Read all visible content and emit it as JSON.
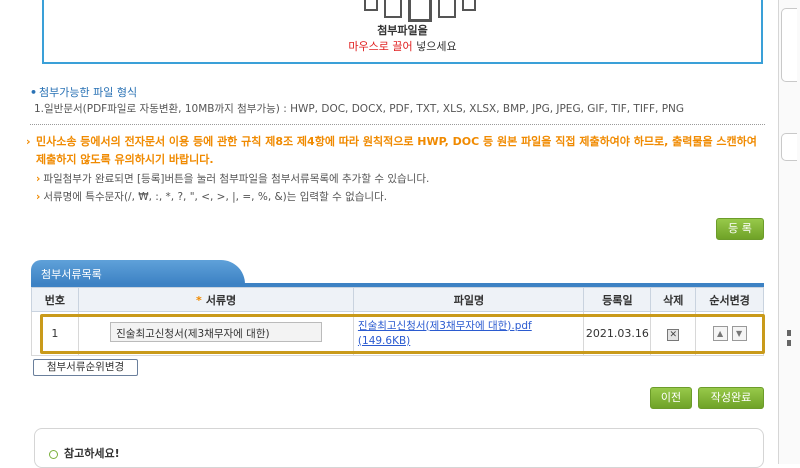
{
  "dropzone": {
    "line1": "첨부파일을",
    "drag_red": "마우스로 끌어",
    "drag_rest": " 넣으세요"
  },
  "allowed": {
    "title": "첨부가능한 파일 형식",
    "text": "1.일반문서(PDF파일로 자동변환, 10MB까지 첨부가능) : HWP, DOC, DOCX, PDF, TXT, XLS, XLSX, BMP, JPG, JPEG, GIF, TIF, TIFF, PNG"
  },
  "notice": {
    "text": "민사소송 등에서의 전자문서 이용 등에 관한 규칙 제8조 제4항에 따라 원칙적으로 HWP, DOC 등 원본 파일을 직접 제출하여야 하므로, 출력물을 스캔하여 제출하지 않도록 유의하시기 바랍니다.",
    "tip1": "파일첨부가 완료되면 [등록]버튼을 눌러 첨부파일을 첨부서류목록에 추가할 수 있습니다.",
    "tip2": "서류명에 특수문자(/, ₩, :, *, ?, \", <, >, |, =, %, &)는 입력할 수 없습니다."
  },
  "buttons": {
    "register": "등 록",
    "reorder": "첨부서류순위변경",
    "prev": "이전",
    "complete": "작성완료"
  },
  "section": {
    "title": "첨부서류목록"
  },
  "table": {
    "headers": {
      "no": "번호",
      "required_mark": "*",
      "name": "서류명",
      "file": "파일명",
      "date": "등록일",
      "delete": "삭제",
      "order": "순서변경"
    },
    "rows": [
      {
        "no": "1",
        "name": "진술최고신청서(제3채무자에 대한)",
        "file": "진술최고신청서(제3채무자에 대한).pdf (149.6KB)",
        "date": "2021.03.16"
      }
    ]
  },
  "check": {
    "title": "참고하세요!"
  },
  "icons": {
    "delete": "delete-icon",
    "up": "arrow-up-icon",
    "down": "arrow-down-icon"
  },
  "colors": {
    "accent_blue": "#3d82c4",
    "notice_orange": "#f08a00",
    "button_green": "#6fa227",
    "highlight_gold": "#c99a1a"
  }
}
